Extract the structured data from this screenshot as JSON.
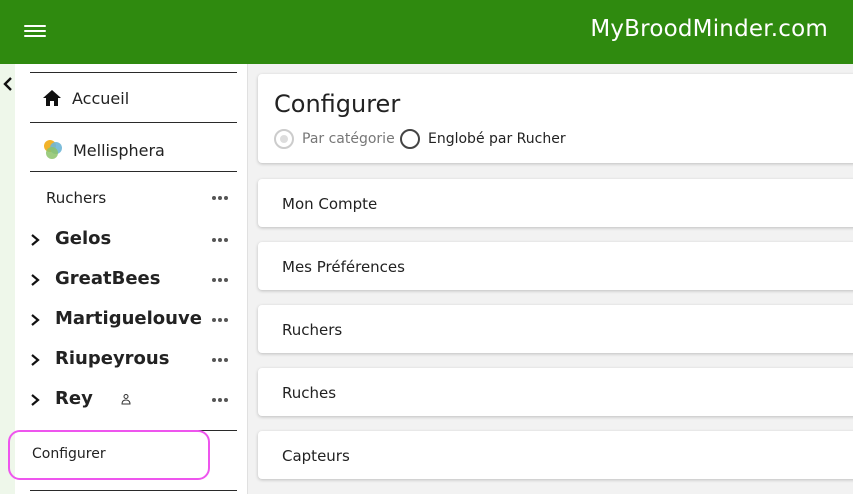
{
  "app": {
    "brand": "MyBroodMinder.com"
  },
  "icons": {
    "menu": "hamburger-menu-icon",
    "collapse": "chevron-left-icon",
    "home": "home-icon",
    "mellisphera": "mellisphera-logo-icon",
    "expand": "chevron-right-icon",
    "more": "more-horizontal-icon",
    "user": "user-icon"
  },
  "colors": {
    "topbar": "#2f8a0f",
    "highlight": "#ee55ee"
  },
  "sidebar": {
    "home_label": "Accueil",
    "mellisphera_label": "Mellisphera",
    "ruchers_label": "Ruchers",
    "apiaries": [
      {
        "name": "Gelos"
      },
      {
        "name": "GreatBees"
      },
      {
        "name": "Martiguelouve"
      },
      {
        "name": "Riupeyrous"
      },
      {
        "name": "Rey"
      }
    ],
    "configurer_label": "Configurer"
  },
  "main": {
    "title": "Configurer",
    "view_options": [
      {
        "label": "Par catégorie",
        "selected": true,
        "disabled": true
      },
      {
        "label": "Englobé par Rucher",
        "selected": false,
        "disabled": false
      }
    ],
    "sections": [
      {
        "label": "Mon Compte"
      },
      {
        "label": "Mes Préférences"
      },
      {
        "label": "Ruchers"
      },
      {
        "label": "Ruches"
      },
      {
        "label": "Capteurs"
      }
    ]
  }
}
